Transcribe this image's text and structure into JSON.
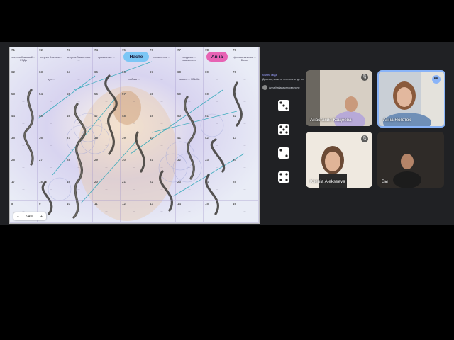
{
  "board": {
    "player_tags": {
      "nastye": "Насте",
      "anna": "Анна"
    },
    "zoom": {
      "minus": "−",
      "level": "94%",
      "plus": "+"
    },
    "cells": [
      {
        "n": "71",
        "t": "энергия Кошачьей ... РОДА"
      },
      {
        "n": "72",
        "t": "энергия благости ..."
      },
      {
        "n": "73",
        "t": "энергия Благостных ..."
      },
      {
        "n": "74",
        "t": "проявление ..."
      },
      {
        "n": "75",
        "t": ""
      },
      {
        "n": "76",
        "t": "проявление ..."
      },
      {
        "n": "77",
        "t": "создание ... взаимности"
      },
      {
        "n": "78",
        "t": "гармонизация ..."
      },
      {
        "n": "79",
        "t": "феноменальные ... Бытия"
      },
      {
        "n": "62",
        "t": ""
      },
      {
        "n": "63",
        "t": "дух ..."
      },
      {
        "n": "64",
        "t": "..."
      },
      {
        "n": "65",
        "t": "..."
      },
      {
        "n": "66",
        "t": "любовь ..."
      },
      {
        "n": "67",
        "t": "..."
      },
      {
        "n": "68",
        "t": "начало ... ЯЗЫКА"
      },
      {
        "n": "69",
        "t": "..."
      },
      {
        "n": "70",
        "t": "..."
      },
      {
        "n": "53",
        "t": "..."
      },
      {
        "n": "54",
        "t": "..."
      },
      {
        "n": "55",
        "t": "..."
      },
      {
        "n": "56",
        "t": "..."
      },
      {
        "n": "57",
        "t": "..."
      },
      {
        "n": "58",
        "t": "..."
      },
      {
        "n": "59",
        "t": "..."
      },
      {
        "n": "60",
        "t": "..."
      },
      {
        "n": "61",
        "t": "..."
      },
      {
        "n": "44",
        "t": "..."
      },
      {
        "n": "45",
        "t": "..."
      },
      {
        "n": "46",
        "t": "..."
      },
      {
        "n": "47",
        "t": "..."
      },
      {
        "n": "48",
        "t": "..."
      },
      {
        "n": "49",
        "t": "..."
      },
      {
        "n": "50",
        "t": "..."
      },
      {
        "n": "51",
        "t": "..."
      },
      {
        "n": "52",
        "t": "..."
      },
      {
        "n": "35",
        "t": "..."
      },
      {
        "n": "36",
        "t": "..."
      },
      {
        "n": "37",
        "t": "..."
      },
      {
        "n": "38",
        "t": "..."
      },
      {
        "n": "39",
        "t": "..."
      },
      {
        "n": "40",
        "t": "..."
      },
      {
        "n": "41",
        "t": "..."
      },
      {
        "n": "42",
        "t": "..."
      },
      {
        "n": "43",
        "t": "..."
      },
      {
        "n": "26",
        "t": "..."
      },
      {
        "n": "27",
        "t": "..."
      },
      {
        "n": "28",
        "t": "..."
      },
      {
        "n": "29",
        "t": "..."
      },
      {
        "n": "30",
        "t": "..."
      },
      {
        "n": "31",
        "t": "..."
      },
      {
        "n": "32",
        "t": "..."
      },
      {
        "n": "33",
        "t": "..."
      },
      {
        "n": "34",
        "t": "..."
      },
      {
        "n": "17",
        "t": "..."
      },
      {
        "n": "18",
        "t": "..."
      },
      {
        "n": "19",
        "t": "..."
      },
      {
        "n": "20",
        "t": "..."
      },
      {
        "n": "21",
        "t": "..."
      },
      {
        "n": "22",
        "t": "..."
      },
      {
        "n": "23",
        "t": "..."
      },
      {
        "n": "24",
        "t": "..."
      },
      {
        "n": "25",
        "t": "..."
      },
      {
        "n": "8",
        "t": "..."
      },
      {
        "n": "9",
        "t": "..."
      },
      {
        "n": "10",
        "t": "..."
      },
      {
        "n": "11",
        "t": "..."
      },
      {
        "n": "12",
        "t": "..."
      },
      {
        "n": "13",
        "t": "..."
      },
      {
        "n": "14",
        "t": "..."
      },
      {
        "n": "15",
        "t": "..."
      },
      {
        "n": "16",
        "t": "..."
      }
    ]
  },
  "chat": {
    "title": "Кликни сюда",
    "message": "Девочки, можете это понять где он",
    "user": "Анна Кабаначенкова поле"
  },
  "dice": {
    "icon": "dice-icon",
    "count": 4
  },
  "participants": [
    {
      "name": "Анастасия Кощеева",
      "mic": "muted",
      "color": "#cbbfb4"
    },
    {
      "name": "Анна Ноготок",
      "mic": "active",
      "color": "#a7b6c2"
    },
    {
      "name": "Ksenia Alekseeva",
      "mic": "muted",
      "color": "#e2d8cc"
    },
    {
      "name": "Вы",
      "mic": "none",
      "color": "#3a3530"
    }
  ],
  "colors": {
    "background": "#000000",
    "meeting_bg": "#202124",
    "tile_bg": "#3c4043",
    "active_speaker_border": "#8ab4f8",
    "tag_nastye": "#7cc6f5",
    "tag_anna": "#e763b4"
  }
}
